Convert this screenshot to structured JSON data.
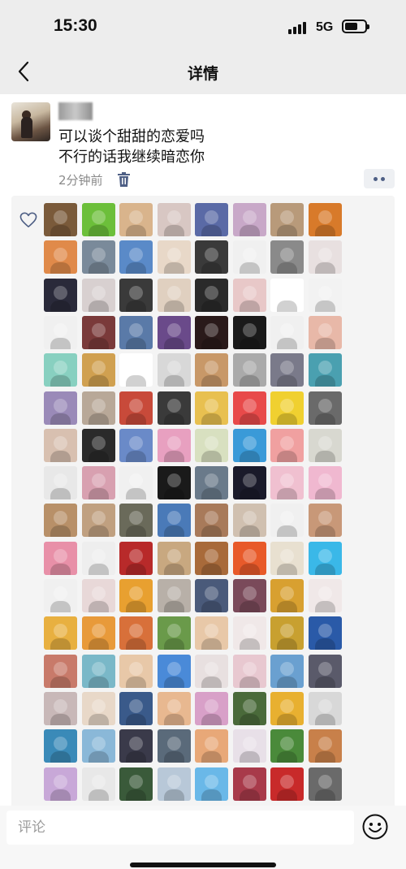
{
  "status_bar": {
    "time": "15:30",
    "network": "5G"
  },
  "nav": {
    "title": "详情",
    "back_icon": "chevron-left-icon"
  },
  "post": {
    "text": "可以谈个甜甜的恋爱吗\n不行的话我继续暗恋你",
    "time": "2分钟前",
    "delete_icon": "trash-icon",
    "more_icon": "more-dots-icon"
  },
  "likes": {
    "icon": "heart-icon",
    "accent_color": "#4e5f85",
    "avatar_colors": [
      "#7a5a3a",
      "#6cbf3a",
      "#d9b48c",
      "#d8c7c3",
      "#5a6aa6",
      "#c8a8c8",
      "#b89a7a",
      "#d87a2a",
      "#e08a4a",
      "#7a8a9a",
      "#5a8ac8",
      "#e8d8c8",
      "#3a3a3a",
      "#f0f0f0",
      "#8a8a8a",
      "#e8e0e0",
      "#2a2a3a",
      "#d8d0d0",
      "#3a3a3a",
      "#e0d0c0",
      "#2a2a2a",
      "#e8c8c8",
      "#ffffff",
      "#f2f2f2",
      "#f0f0f0",
      "#7a3a3a",
      "#5a7aa8",
      "#6a4a8a",
      "#2a1a1a",
      "#1a1a1a",
      "#f0f0f0",
      "#e8b8a8",
      "#88d0c0",
      "#d0a050",
      "#ffffff",
      "#d8d8d8",
      "#c89868",
      "#aaaaaa",
      "#7a7a8a",
      "#4aa0b0",
      "#9a8ab8",
      "#b8a898",
      "#c84a3a",
      "#3a3a3a",
      "#e8c050",
      "#e84a4a",
      "#f0d030",
      "#6a6a6a",
      "#d8c0b0",
      "#2a2a2a",
      "#6a8ac8",
      "#e8a0c0",
      "#d8e0c0",
      "#3a9ad8",
      "#f0a0a0",
      "#d8d8d0",
      "#e8e8e8",
      "#d8a0b0",
      "#f0f0f0",
      "#1a1a1a",
      "#6a7a8a",
      "#1a1a2a",
      "#f0c0d0",
      "#f0b8d0",
      "#b89068",
      "#c0a080",
      "#6a6a5a",
      "#4a7ab8",
      "#a87a5a",
      "#d0c0b0",
      "#f0f0f0",
      "#c89878",
      "#e890a8",
      "#eeeeee",
      "#b82a2a",
      "#c8a880",
      "#a86a3a",
      "#e85a2a",
      "#e8e0d0",
      "#3ab8e8",
      "#f0f0f0",
      "#e8d8d8",
      "#e8a030",
      "#b8b0a8",
      "#4a5a7a",
      "#7a4a5a",
      "#d8a030",
      "#f0e8e8",
      "#e8b040",
      "#e89a3a",
      "#d8703a",
      "#6a9a4a",
      "#e8c8a8",
      "#f0e8e8",
      "#c8a030",
      "#2a5aa8",
      "#c87a6a",
      "#7ab8c8",
      "#e8c8a8",
      "#4a8ad8",
      "#e8e0e0",
      "#e8c8d0",
      "#6aa0d0",
      "#5a5a6a",
      "#c8b8b8",
      "#e8d8c8",
      "#3a5a8a",
      "#e8b890",
      "#d8a0c8",
      "#4a6a3a",
      "#e8b030",
      "#d8d8d8",
      "#3a8ab8",
      "#8ab8d8",
      "#3a3a4a",
      "#5a6a7a",
      "#e8a878",
      "#e8e0e8",
      "#4a8a3a",
      "#c8804a",
      "#c8a8d8",
      "#e8e8e8",
      "#3a5a3a",
      "#b8c8d8",
      "#6ab8e8",
      "#a83a4a",
      "#c82a2a",
      "#6a6a6a"
    ]
  },
  "comment": {
    "placeholder": "评论",
    "emoji_icon": "emoji-smile-icon"
  }
}
